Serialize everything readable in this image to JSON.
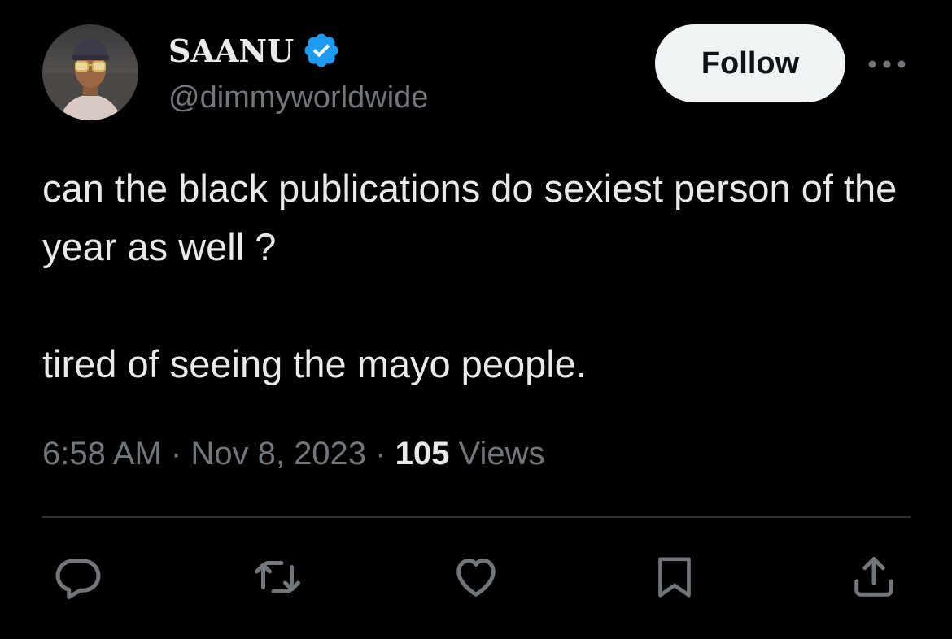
{
  "author": {
    "display_name": "SAANU",
    "handle": "@dimmyworldwide",
    "verified": true
  },
  "follow_label": "Follow",
  "tweet": {
    "paragraphs": [
      "can the black publications do sexiest person of the year as well ?",
      "tired of seeing the mayo people."
    ]
  },
  "meta": {
    "time": "6:58 AM",
    "separator": "·",
    "date": "Nov 8, 2023",
    "views_count": "105",
    "views_label": "Views"
  },
  "actions": [
    {
      "name": "reply",
      "icon": "reply-icon"
    },
    {
      "name": "retweet",
      "icon": "retweet-icon"
    },
    {
      "name": "like",
      "icon": "heart-icon"
    },
    {
      "name": "bookmark",
      "icon": "bookmark-icon"
    },
    {
      "name": "share",
      "icon": "share-icon"
    }
  ],
  "colors": {
    "background": "#000000",
    "text": "#e7e9ea",
    "secondary_text": "#71767b",
    "verified_blue": "#1d9bf0",
    "follow_button_bg": "#eff3f4",
    "follow_button_text": "#0f1419",
    "divider": "#2f3336"
  }
}
